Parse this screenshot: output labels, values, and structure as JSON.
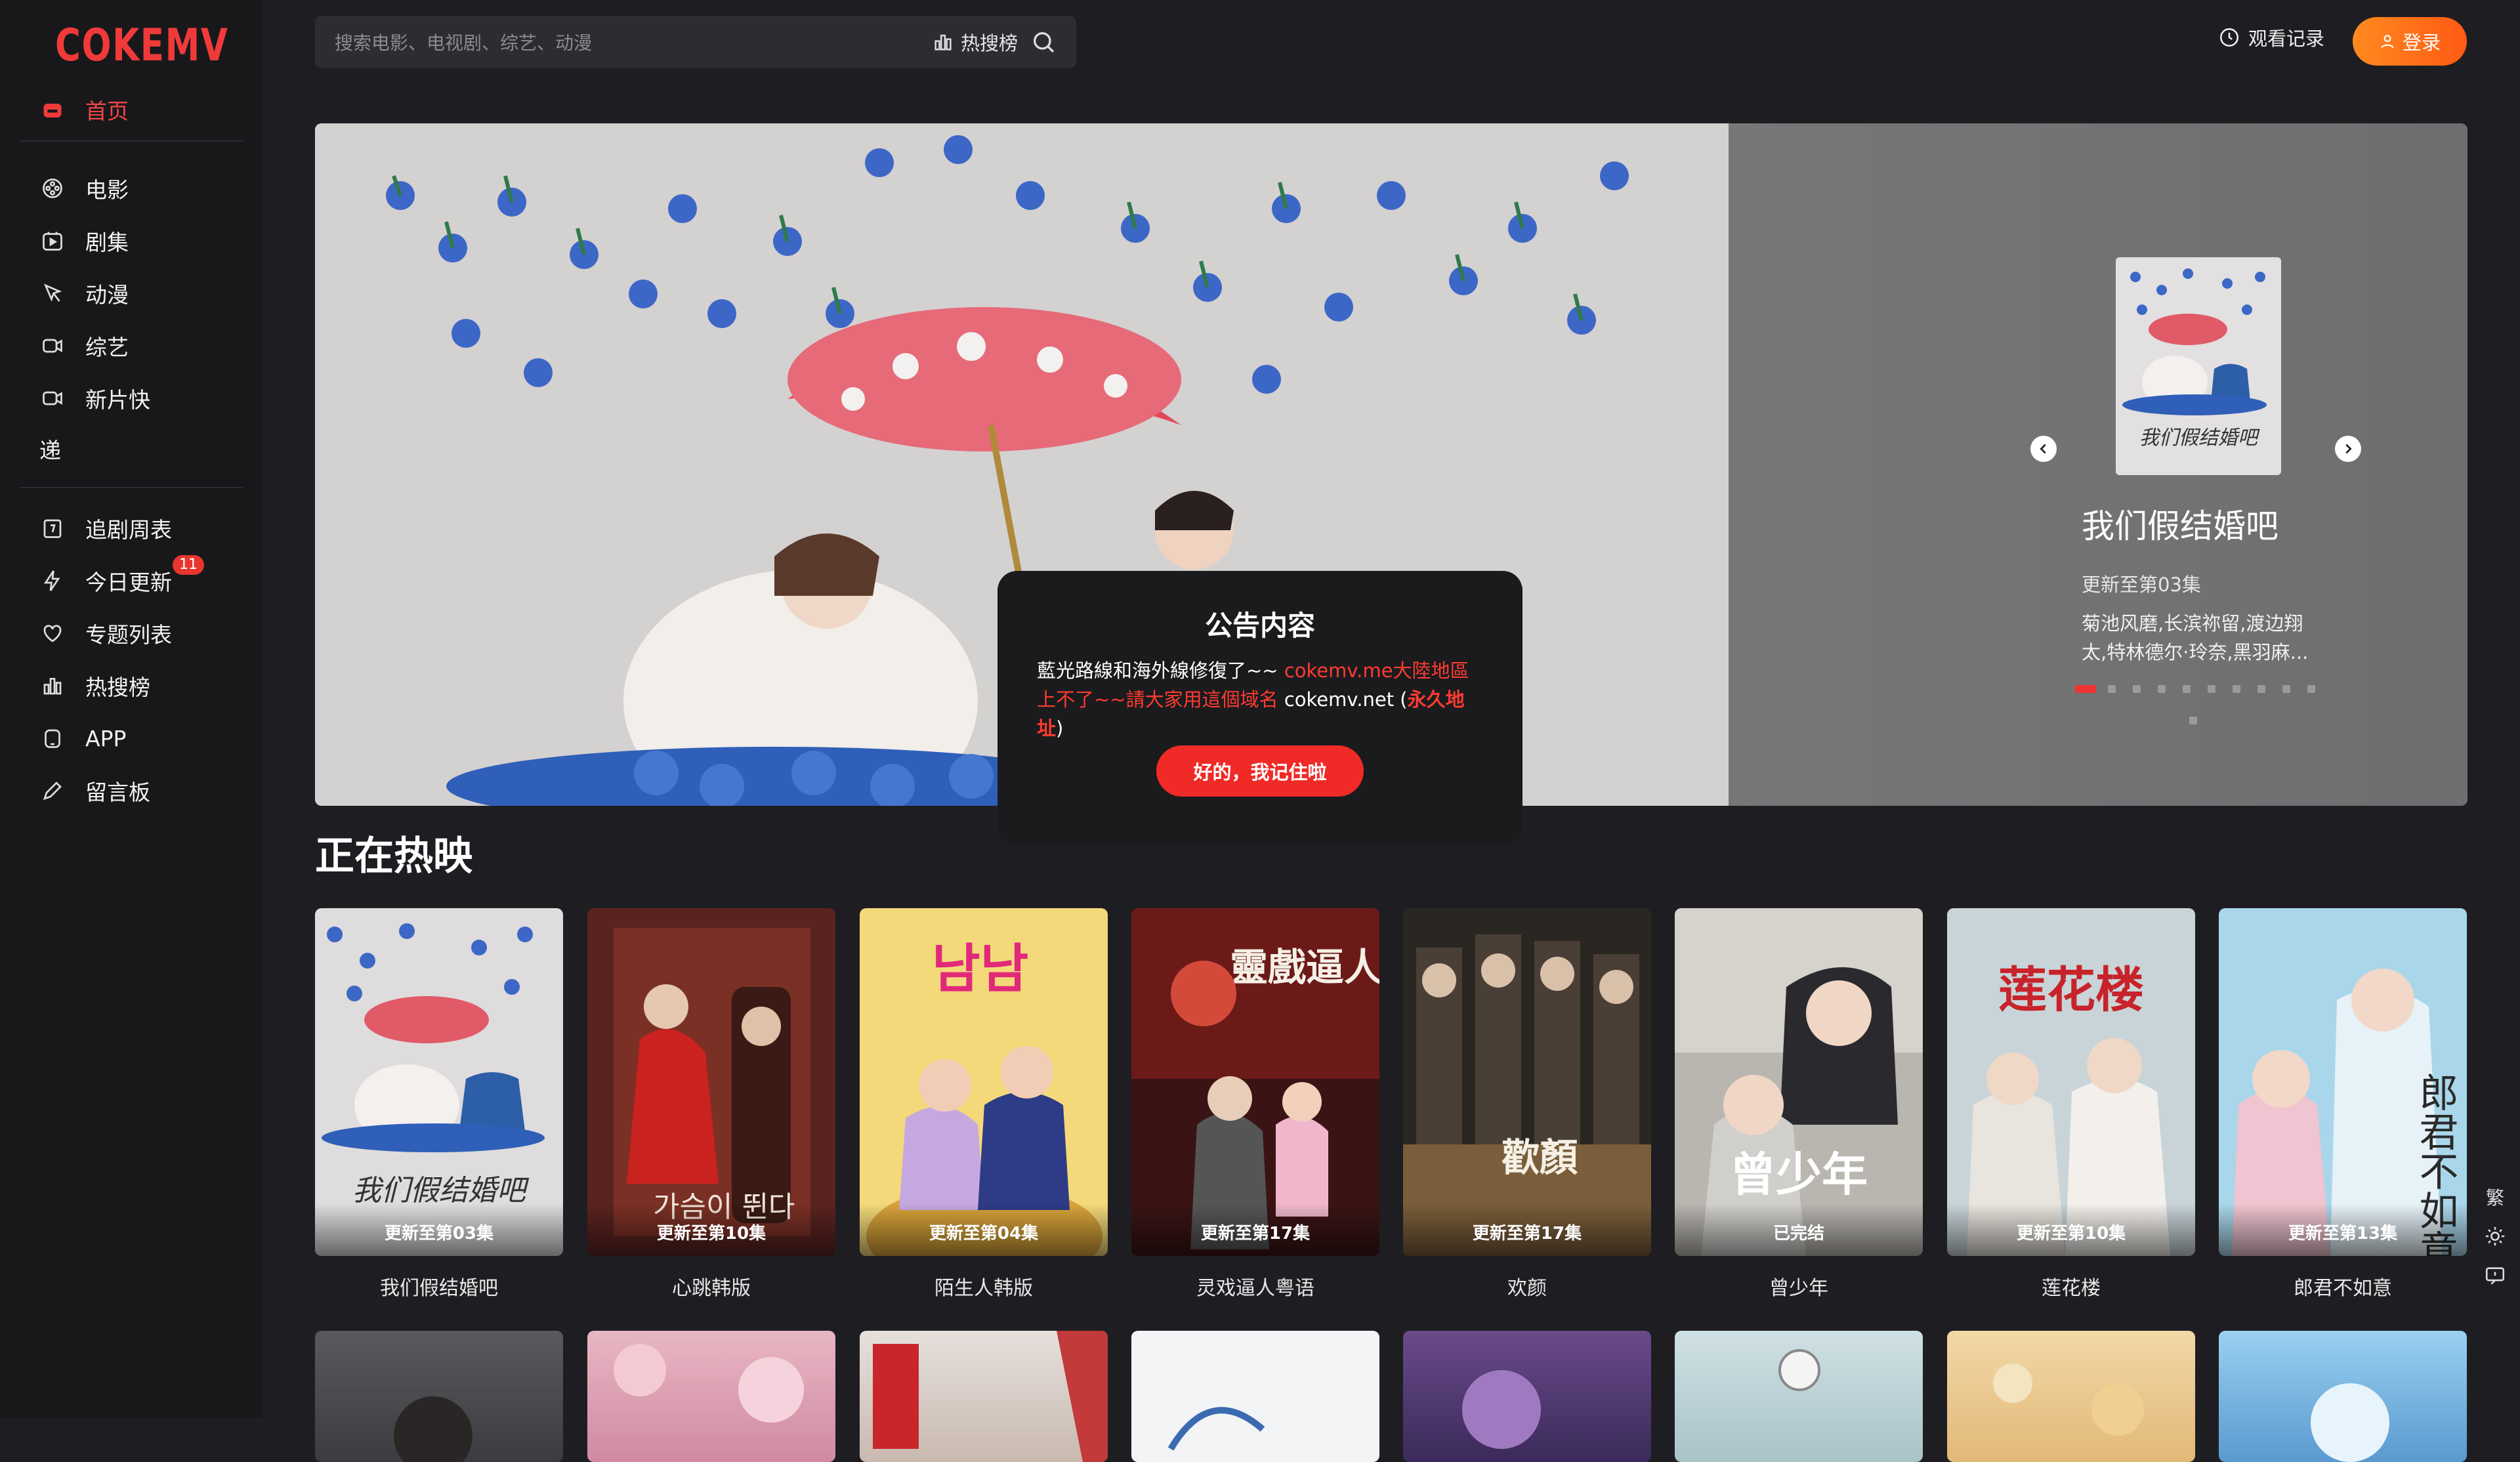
{
  "brand": {
    "logo": "COKEMV",
    "accent": "#f03a3a"
  },
  "sidebar": {
    "home": {
      "label": "首页",
      "icon": "home-icon"
    },
    "items": [
      {
        "label": "电影",
        "icon": "film-reel-icon"
      },
      {
        "label": "剧集",
        "icon": "play-square-icon"
      },
      {
        "label": "动漫",
        "icon": "anime-icon"
      },
      {
        "label": "综艺",
        "icon": "video-camera-icon"
      },
      {
        "label": "新片快",
        "icon": "video-camera-icon"
      }
    ],
    "orphan_label": "递",
    "items2": [
      {
        "label": "追剧周表",
        "icon": "calendar-icon"
      },
      {
        "label": "今日更新",
        "icon": "lightning-icon",
        "badge": "11"
      },
      {
        "label": "专题列表",
        "icon": "heart-icon"
      },
      {
        "label": "热搜榜",
        "icon": "bar-chart-icon"
      },
      {
        "label": "APP",
        "icon": "phone-icon"
      },
      {
        "label": "留言板",
        "icon": "pencil-icon"
      }
    ]
  },
  "header": {
    "search_placeholder": "搜索电影、电视剧、综艺、动漫",
    "hot_label": "热搜榜",
    "history_label": "观看记录",
    "login_label": "登录"
  },
  "banner": {
    "title": "我们假结婚吧",
    "episode": "更新至第03集",
    "cast": "菊池风磨,长滨祢留,渡边翔太,特林德尔·玲奈,黑羽麻..."
  },
  "notice": {
    "title": "公告内容",
    "text1": "藍光路線和海外線修復了~~ ",
    "text2_red": "cokemv.me大陸地區上不了~~請大家用這個域名",
    "text3": " cokemv.net (",
    "text4_red": "永久地址",
    "text5": ")",
    "button": "好的，我记住啦"
  },
  "section": {
    "title": "正在热映",
    "cards": [
      {
        "name": "我们假结婚吧",
        "ep": "更新至第03集"
      },
      {
        "name": "心跳韩版",
        "ep": "更新至第10集"
      },
      {
        "name": "陌生人韩版",
        "ep": "更新至第04集"
      },
      {
        "name": "灵戏逼人粤语",
        "ep": "更新至第17集"
      },
      {
        "name": "欢颜",
        "ep": "更新至第17集"
      },
      {
        "name": "曾少年",
        "ep": "已完结"
      },
      {
        "name": "莲花楼",
        "ep": "更新至第10集"
      },
      {
        "name": "郎君不如意",
        "ep": "更新至第13集"
      }
    ]
  },
  "poster_text": {
    "p1": "我们假结婚吧",
    "p2": "가슴이 뛴다",
    "p3": "남남",
    "p4": "靈戲逼人",
    "p5": "歡顏",
    "p6": "曾少年",
    "p7": "莲花楼",
    "p8": "郎君不如意"
  },
  "float_tools": {
    "traditional": "繁"
  }
}
